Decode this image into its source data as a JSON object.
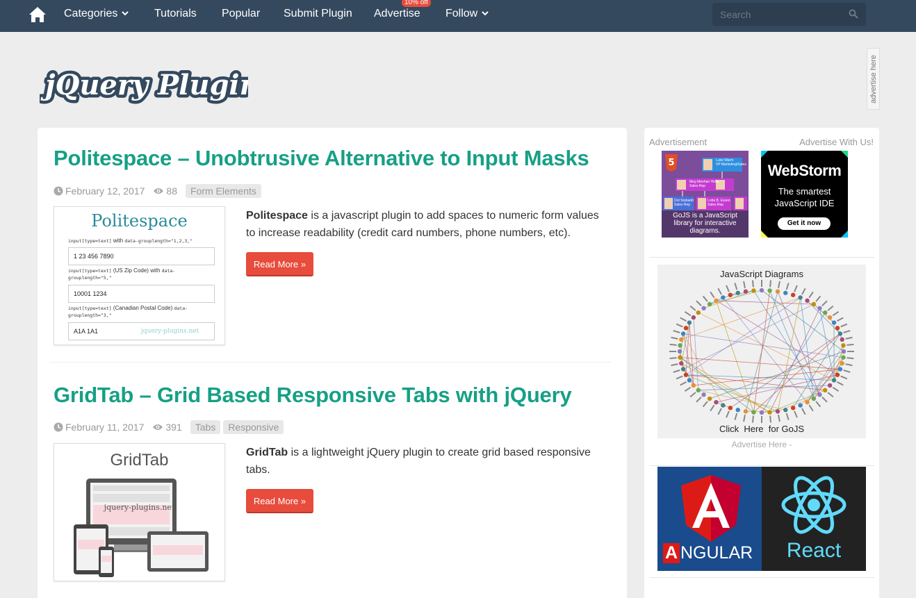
{
  "nav": {
    "categories": "Categories",
    "tutorials": "Tutorials",
    "popular": "Popular",
    "submit": "Submit Plugin",
    "advertise": "Advertise",
    "advertise_badge": "10% off",
    "follow": "Follow",
    "search_placeholder": "Search"
  },
  "logo_text": "jQuery Plugins",
  "advertise_tab": "advertise here",
  "posts": [
    {
      "title": "Politespace – Unobtrusive Alternative to Input Masks",
      "date": "February 12, 2017",
      "views": "88",
      "tags": [
        "Form Elements"
      ],
      "excerpt_bold": "Politespace",
      "excerpt": " is a javascript plugin to add spaces to numeric form values to increase readability (credit card numbers, phone numbers, etc).",
      "read_more": "Read More »",
      "thumb": {
        "title": "Politespace",
        "label1_code": "input[type=text]",
        "label1_text": " with ",
        "label1_code2": "data-grouplength=\"1,2,3,\"",
        "value1": "1 23 456 7890",
        "label2_code": "input[type=text]",
        "label2_text": " (US Zip Code) with ",
        "label2_code2": "data-grouplength=\"5,\"",
        "value2": "10001 1234",
        "label3_code": "input[type=text]",
        "label3_text": " (Canadian Postal Code) ",
        "label3_code2": "data-grouplength=\"3,\"",
        "value3": "A1A 1A1",
        "watermark": "jquery-plugins.net"
      }
    },
    {
      "title": "GridTab – Grid Based Responsive Tabs with jQuery",
      "date": "February 11, 2017",
      "views": "391",
      "tags": [
        "Tabs",
        "Responsive"
      ],
      "excerpt_bold": "GridTab",
      "excerpt": " is a lightweight jQuery plugin to create grid based responsive tabs.",
      "read_more": "Read More »",
      "thumb": {
        "title": "GridTab",
        "watermark": "jquery-plugins.net"
      }
    }
  ],
  "sidebar": {
    "advertisement": "Advertisement",
    "advertise_with_us": "Advertise With Us!",
    "ad_gojs": {
      "text": "GoJS is a JavaScript library for interactive diagrams.",
      "people": [
        {
          "name": "Luke Warm",
          "role": "VP Marketing/Sales"
        },
        {
          "name": "Meg Meehan Hoffa",
          "role": "Sales Rep"
        },
        {
          "name": "Lotta B. Essen",
          "role": "Sales Rep"
        },
        {
          "name": "Dot Stubadd",
          "role": "Sales Rep"
        }
      ]
    },
    "ad_webstorm": {
      "title": "WebStorm",
      "line1": "The smartest",
      "line2": "JavaScript IDE",
      "button": "Get it now"
    },
    "diagram_ad": {
      "title": "JavaScript Diagrams",
      "cta": "Click  Here  for GoJS"
    },
    "advertise_here": "Advertise Here -",
    "angular": "NGULAR",
    "angular_letter": "A",
    "react": "React"
  },
  "colors": {
    "nav": "#34495e",
    "title": "#16a085",
    "button": "#e74c3c",
    "angular": "#dd1b16",
    "react": "#61dafb"
  }
}
